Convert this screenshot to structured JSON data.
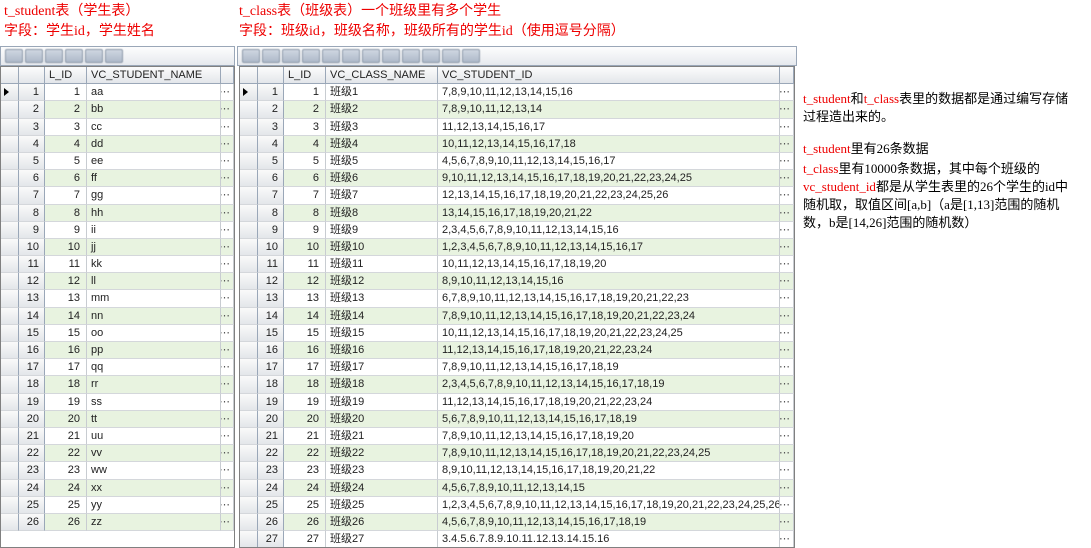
{
  "annot": {
    "left_line1": "t_student表（学生表）",
    "left_line2": "字段：学生id，学生姓名",
    "right_line1": "t_class表（班级表）一个班级里有多个学生",
    "right_line2": "字段：班级id，班级名称，班级所有的学生id（使用逗号分隔）"
  },
  "left_grid": {
    "headers": {
      "lid": "L_ID",
      "name": "VC_STUDENT_NAME"
    },
    "rows": [
      {
        "id": "1",
        "name": "aa"
      },
      {
        "id": "2",
        "name": "bb"
      },
      {
        "id": "3",
        "name": "cc"
      },
      {
        "id": "4",
        "name": "dd"
      },
      {
        "id": "5",
        "name": "ee"
      },
      {
        "id": "6",
        "name": "ff"
      },
      {
        "id": "7",
        "name": "gg"
      },
      {
        "id": "8",
        "name": "hh"
      },
      {
        "id": "9",
        "name": "ii"
      },
      {
        "id": "10",
        "name": "jj"
      },
      {
        "id": "11",
        "name": "kk"
      },
      {
        "id": "12",
        "name": "ll"
      },
      {
        "id": "13",
        "name": "mm"
      },
      {
        "id": "14",
        "name": "nn"
      },
      {
        "id": "15",
        "name": "oo"
      },
      {
        "id": "16",
        "name": "pp"
      },
      {
        "id": "17",
        "name": "qq"
      },
      {
        "id": "18",
        "name": "rr"
      },
      {
        "id": "19",
        "name": "ss"
      },
      {
        "id": "20",
        "name": "tt"
      },
      {
        "id": "21",
        "name": "uu"
      },
      {
        "id": "22",
        "name": "vv"
      },
      {
        "id": "23",
        "name": "ww"
      },
      {
        "id": "24",
        "name": "xx"
      },
      {
        "id": "25",
        "name": "yy"
      },
      {
        "id": "26",
        "name": "zz"
      }
    ]
  },
  "right_grid": {
    "headers": {
      "lid": "L_ID",
      "name": "VC_CLASS_NAME",
      "sid": "VC_STUDENT_ID"
    },
    "rows": [
      {
        "id": "1",
        "name": "班级1",
        "sid": "7,8,9,10,11,12,13,14,15,16"
      },
      {
        "id": "2",
        "name": "班级2",
        "sid": "7,8,9,10,11,12,13,14"
      },
      {
        "id": "3",
        "name": "班级3",
        "sid": "11,12,13,14,15,16,17"
      },
      {
        "id": "4",
        "name": "班级4",
        "sid": "10,11,12,13,14,15,16,17,18"
      },
      {
        "id": "5",
        "name": "班级5",
        "sid": "4,5,6,7,8,9,10,11,12,13,14,15,16,17"
      },
      {
        "id": "6",
        "name": "班级6",
        "sid": "9,10,11,12,13,14,15,16,17,18,19,20,21,22,23,24,25"
      },
      {
        "id": "7",
        "name": "班级7",
        "sid": "12,13,14,15,16,17,18,19,20,21,22,23,24,25,26"
      },
      {
        "id": "8",
        "name": "班级8",
        "sid": "13,14,15,16,17,18,19,20,21,22"
      },
      {
        "id": "9",
        "name": "班级9",
        "sid": "2,3,4,5,6,7,8,9,10,11,12,13,14,15,16"
      },
      {
        "id": "10",
        "name": "班级10",
        "sid": "1,2,3,4,5,6,7,8,9,10,11,12,13,14,15,16,17"
      },
      {
        "id": "11",
        "name": "班级11",
        "sid": "10,11,12,13,14,15,16,17,18,19,20"
      },
      {
        "id": "12",
        "name": "班级12",
        "sid": "8,9,10,11,12,13,14,15,16"
      },
      {
        "id": "13",
        "name": "班级13",
        "sid": "6,7,8,9,10,11,12,13,14,15,16,17,18,19,20,21,22,23"
      },
      {
        "id": "14",
        "name": "班级14",
        "sid": "7,8,9,10,11,12,13,14,15,16,17,18,19,20,21,22,23,24"
      },
      {
        "id": "15",
        "name": "班级15",
        "sid": "10,11,12,13,14,15,16,17,18,19,20,21,22,23,24,25"
      },
      {
        "id": "16",
        "name": "班级16",
        "sid": "11,12,13,14,15,16,17,18,19,20,21,22,23,24"
      },
      {
        "id": "17",
        "name": "班级17",
        "sid": "7,8,9,10,11,12,13,14,15,16,17,18,19"
      },
      {
        "id": "18",
        "name": "班级18",
        "sid": "2,3,4,5,6,7,8,9,10,11,12,13,14,15,16,17,18,19"
      },
      {
        "id": "19",
        "name": "班级19",
        "sid": "11,12,13,14,15,16,17,18,19,20,21,22,23,24"
      },
      {
        "id": "20",
        "name": "班级20",
        "sid": "5,6,7,8,9,10,11,12,13,14,15,16,17,18,19"
      },
      {
        "id": "21",
        "name": "班级21",
        "sid": "7,8,9,10,11,12,13,14,15,16,17,18,19,20"
      },
      {
        "id": "22",
        "name": "班级22",
        "sid": "7,8,9,10,11,12,13,14,15,16,17,18,19,20,21,22,23,24,25"
      },
      {
        "id": "23",
        "name": "班级23",
        "sid": "8,9,10,11,12,13,14,15,16,17,18,19,20,21,22"
      },
      {
        "id": "24",
        "name": "班级24",
        "sid": "4,5,6,7,8,9,10,11,12,13,14,15"
      },
      {
        "id": "25",
        "name": "班级25",
        "sid": "1,2,3,4,5,6,7,8,9,10,11,12,13,14,15,16,17,18,19,20,21,22,23,24,25,26"
      },
      {
        "id": "26",
        "name": "班级26",
        "sid": "4,5,6,7,8,9,10,11,12,13,14,15,16,17,18,19"
      },
      {
        "id": "27",
        "name": "班级27",
        "sid": "3.4.5.6.7.8.9.10.11.12.13.14.15.16"
      }
    ]
  },
  "side": {
    "blk1_a": "t_student",
    "blk1_b": "和",
    "blk1_c": "t_class",
    "blk1_d": "表里的数据都是通过编写存储过程造出来的。",
    "blk2_a": "t_student",
    "blk2_b": "里有26条数据",
    "blk3_a": "t_class",
    "blk3_b": "里有10000条数据，其中每个班级的",
    "blk3_c": "vc_student_id",
    "blk3_d": "都是从学生表里的26个学生的id中随机取，取值区间[a,b]（a是[1,13]范围的随机数，b是[14,26]范围的随机数）"
  }
}
